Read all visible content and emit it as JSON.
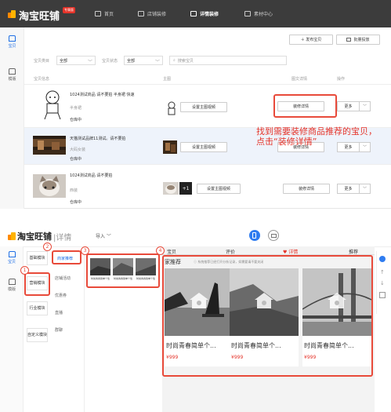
{
  "top": {
    "brand": "淘宝旺铺",
    "badge": "专属版",
    "nav": [
      "首页",
      "店铺装修",
      "详情装修",
      "素材中心"
    ],
    "leftnav": [
      "宝贝",
      "模版"
    ],
    "publish_btn": "＋ 发布宝贝",
    "batch_btn": "批量投放",
    "filter": {
      "type_label": "宝贝类目",
      "type_value": "全部",
      "status_label": "宝贝状态",
      "status_value": "全部",
      "search_placeholder": "搜索宝贝"
    },
    "columns": [
      "宝贝信息",
      "主图",
      "图文详情",
      "操作"
    ],
    "rows": [
      {
        "title": "1024测试商品 请不要拍 半身裙 快速",
        "sub": "半身裙",
        "status": "仓库中",
        "main_btn": "设置主图视频",
        "detail_btn": "装修详情",
        "more": "更多"
      },
      {
        "title": "天猫测试品牌11测试。请不要拍",
        "sub": "大码女装",
        "status": "仓库中",
        "main_btn": "设置主图视频",
        "detail_btn": "装修详情",
        "more": "更多"
      },
      {
        "title": "1024测试商品 请不要拍",
        "sub": "西装",
        "status": "仓库中",
        "main_btn": "设置主图视频",
        "detail_btn": "装修详情",
        "more": "更多",
        "thumb_count": "+1"
      }
    ],
    "callout": [
      "找到需要装修商品推荐的宝贝，",
      "点击“装修详情”"
    ]
  },
  "bottom": {
    "brand": "淘宝旺铺",
    "section": "详情",
    "import": "导入",
    "left_tabs": [
      "宝贝",
      "模版"
    ],
    "modules": [
      "基础模块",
      "营销模块",
      "行业模块",
      "自定义模块"
    ],
    "submodules": [
      "商家推荐",
      "店铺活动",
      "优惠券",
      "直播",
      "群聊"
    ],
    "nums": [
      "1",
      "2",
      "3",
      "4"
    ],
    "preview_tabs": [
      "宝贝",
      "评价",
      "详情",
      "推荐"
    ],
    "rec_title": "家推荐",
    "rec_note": "ⓘ 系统推荐已经打开分析记录，如需要请不要关闭",
    "cards": [
      {
        "title": "时尚青春简单个...",
        "price": "¥999"
      },
      {
        "title": "时尚青春简单个...",
        "price": "¥999"
      },
      {
        "title": "时尚青春简单个...",
        "price": "¥999"
      }
    ],
    "thumb_labels": [
      "时尚青春简单个性",
      "时尚青春简单个性",
      "时尚青春简单个性"
    ]
  },
  "colors": {
    "accent": "#1f6fe5",
    "red": "#e84a3a",
    "dark_bar": "#3c3c3c"
  }
}
